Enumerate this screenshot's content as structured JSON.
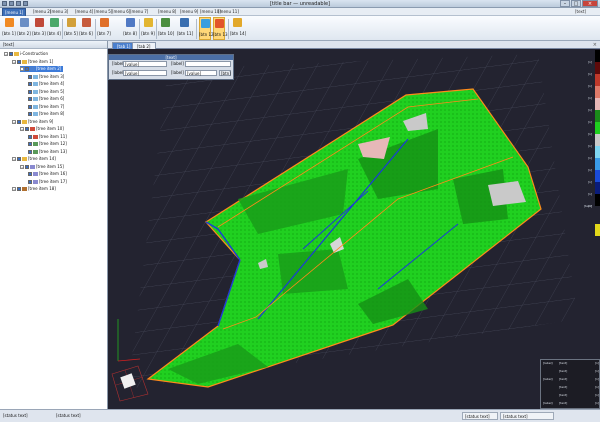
{
  "app": {
    "title": "[title bar — unreadable]",
    "brand": "[text]"
  },
  "menu": {
    "tabs": [
      "[menu 1]",
      "[menu 2]",
      "[menu 3]",
      "[menu 4]",
      "[menu 5]",
      "[menu 6]",
      "[menu 7]",
      "[menu 8]",
      "[menu 9]",
      "[menu 10]",
      "[menu 11]"
    ]
  },
  "ribbon": {
    "buttons": [
      "[btn 1]",
      "[btn 2]",
      "[btn 3]",
      "[btn 4]",
      "[btn 5]",
      "[btn 6]",
      "[btn 7]",
      "[btn 8]",
      "[btn 9]",
      "[btn 10]",
      "[btn 11]",
      "[btn 12]",
      "[btn 13]",
      "[btn 14]",
      "[btn 15]",
      "[btn 16]"
    ]
  },
  "sidebar": {
    "header": "[text]",
    "tree": [
      {
        "label": "i-Construction",
        "level": 0,
        "icon": "folder-icon"
      },
      {
        "label": "[tree item 1]",
        "level": 1,
        "icon": "folder-icon"
      },
      {
        "label": "[tree item 2]",
        "level": 2,
        "icon": "layer-icon",
        "selected": true
      },
      {
        "label": "[tree item 3]",
        "level": 3,
        "icon": "surface-icon"
      },
      {
        "label": "[tree item 4]",
        "level": 3,
        "icon": "surface-icon"
      },
      {
        "label": "[tree item 5]",
        "level": 3,
        "icon": "surface-icon"
      },
      {
        "label": "[tree item 6]",
        "level": 3,
        "icon": "surface-icon"
      },
      {
        "label": "[tree item 7]",
        "level": 3,
        "icon": "surface-icon"
      },
      {
        "label": "[tree item 8]",
        "level": 3,
        "icon": "surface-icon"
      },
      {
        "label": "[tree item 9]",
        "level": 1,
        "icon": "folder-icon"
      },
      {
        "label": "[tree item 10]",
        "level": 2,
        "icon": "heatmap-icon"
      },
      {
        "label": "[tree item 11]",
        "level": 3,
        "icon": "heatmap-icon"
      },
      {
        "label": "[tree item 12]",
        "level": 3,
        "icon": "report-icon"
      },
      {
        "label": "[tree item 13]",
        "level": 3,
        "icon": "report-icon"
      },
      {
        "label": "[tree item 14]",
        "level": 1,
        "icon": "folder-icon"
      },
      {
        "label": "[tree item 15]",
        "level": 2,
        "icon": "mesh-icon"
      },
      {
        "label": "[tree item 16]",
        "level": 3,
        "icon": "mesh-icon"
      },
      {
        "label": "[tree item 17]",
        "level": 3,
        "icon": "mesh-icon"
      },
      {
        "label": "[tree item 18]",
        "level": 1,
        "icon": "camera-icon"
      }
    ]
  },
  "doc": {
    "tabs": [
      "[tab 1]",
      "[tab 2]"
    ]
  },
  "panel": {
    "title": "[text]",
    "row1_label": "[label]",
    "row1_value": "[value]",
    "row1_label2": "[label]",
    "row2_label": "[label]",
    "row2_value": "[value]",
    "row2_label2": "[label]",
    "row2_value2": "[value]",
    "row2_btn": "[btn]"
  },
  "legend": {
    "levels": [
      "[n]",
      "[n]",
      "[n]",
      "[n]",
      "[n]",
      "[n]",
      "[n]",
      "[n]",
      "[n]",
      "[n]",
      "[n]",
      "[n]",
      "[n]"
    ],
    "note": "[text]",
    "colors": [
      "#000000",
      "#5e0a0a",
      "#c0392b",
      "#e07a6a",
      "#e8b8b8",
      "#1a8a1a",
      "#1fd01f",
      "#c9c9c9",
      "#7fd6f2",
      "#3a9be8",
      "#1a4bd8",
      "#0a1c7a",
      "#000000",
      "#e3d81a"
    ]
  },
  "info": {
    "rows": [
      {
        "label": "[label]",
        "a": "[text]",
        "b": "[n]"
      },
      {
        "label": "",
        "a": "[text]",
        "b": "[n]"
      },
      {
        "label": "[label]",
        "a": "[text]",
        "b": "[n]"
      },
      {
        "label": "",
        "a": "[text]",
        "b": "[n]"
      },
      {
        "label": "",
        "a": "[text]",
        "b": "[n]"
      },
      {
        "label": "[label]",
        "a": "[text]",
        "b": "[n]"
      }
    ]
  },
  "status": {
    "left": "[status text]",
    "mid": "[status text]",
    "right1": "[status text]",
    "right2": "[status text]"
  }
}
